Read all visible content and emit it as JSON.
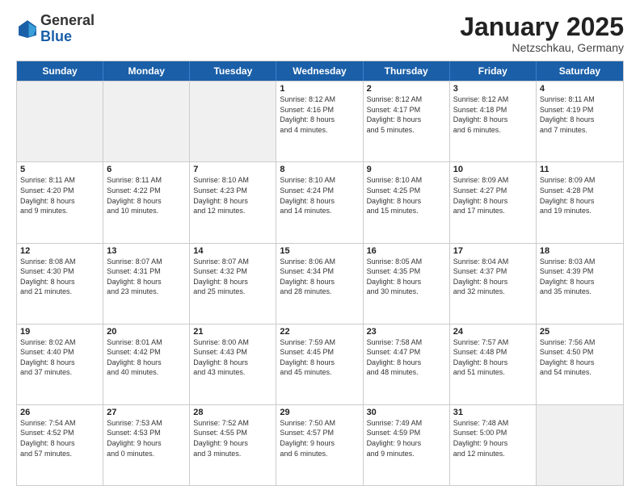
{
  "header": {
    "logo_general": "General",
    "logo_blue": "Blue",
    "month_title": "January 2025",
    "location": "Netzschkau, Germany"
  },
  "weekdays": [
    "Sunday",
    "Monday",
    "Tuesday",
    "Wednesday",
    "Thursday",
    "Friday",
    "Saturday"
  ],
  "rows": [
    [
      {
        "day": "",
        "info": "",
        "shaded": true
      },
      {
        "day": "",
        "info": "",
        "shaded": true
      },
      {
        "day": "",
        "info": "",
        "shaded": true
      },
      {
        "day": "1",
        "info": "Sunrise: 8:12 AM\nSunset: 4:16 PM\nDaylight: 8 hours\nand 4 minutes.",
        "shaded": false
      },
      {
        "day": "2",
        "info": "Sunrise: 8:12 AM\nSunset: 4:17 PM\nDaylight: 8 hours\nand 5 minutes.",
        "shaded": false
      },
      {
        "day": "3",
        "info": "Sunrise: 8:12 AM\nSunset: 4:18 PM\nDaylight: 8 hours\nand 6 minutes.",
        "shaded": false
      },
      {
        "day": "4",
        "info": "Sunrise: 8:11 AM\nSunset: 4:19 PM\nDaylight: 8 hours\nand 7 minutes.",
        "shaded": false
      }
    ],
    [
      {
        "day": "5",
        "info": "Sunrise: 8:11 AM\nSunset: 4:20 PM\nDaylight: 8 hours\nand 9 minutes.",
        "shaded": false
      },
      {
        "day": "6",
        "info": "Sunrise: 8:11 AM\nSunset: 4:22 PM\nDaylight: 8 hours\nand 10 minutes.",
        "shaded": false
      },
      {
        "day": "7",
        "info": "Sunrise: 8:10 AM\nSunset: 4:23 PM\nDaylight: 8 hours\nand 12 minutes.",
        "shaded": false
      },
      {
        "day": "8",
        "info": "Sunrise: 8:10 AM\nSunset: 4:24 PM\nDaylight: 8 hours\nand 14 minutes.",
        "shaded": false
      },
      {
        "day": "9",
        "info": "Sunrise: 8:10 AM\nSunset: 4:25 PM\nDaylight: 8 hours\nand 15 minutes.",
        "shaded": false
      },
      {
        "day": "10",
        "info": "Sunrise: 8:09 AM\nSunset: 4:27 PM\nDaylight: 8 hours\nand 17 minutes.",
        "shaded": false
      },
      {
        "day": "11",
        "info": "Sunrise: 8:09 AM\nSunset: 4:28 PM\nDaylight: 8 hours\nand 19 minutes.",
        "shaded": false
      }
    ],
    [
      {
        "day": "12",
        "info": "Sunrise: 8:08 AM\nSunset: 4:30 PM\nDaylight: 8 hours\nand 21 minutes.",
        "shaded": false
      },
      {
        "day": "13",
        "info": "Sunrise: 8:07 AM\nSunset: 4:31 PM\nDaylight: 8 hours\nand 23 minutes.",
        "shaded": false
      },
      {
        "day": "14",
        "info": "Sunrise: 8:07 AM\nSunset: 4:32 PM\nDaylight: 8 hours\nand 25 minutes.",
        "shaded": false
      },
      {
        "day": "15",
        "info": "Sunrise: 8:06 AM\nSunset: 4:34 PM\nDaylight: 8 hours\nand 28 minutes.",
        "shaded": false
      },
      {
        "day": "16",
        "info": "Sunrise: 8:05 AM\nSunset: 4:35 PM\nDaylight: 8 hours\nand 30 minutes.",
        "shaded": false
      },
      {
        "day": "17",
        "info": "Sunrise: 8:04 AM\nSunset: 4:37 PM\nDaylight: 8 hours\nand 32 minutes.",
        "shaded": false
      },
      {
        "day": "18",
        "info": "Sunrise: 8:03 AM\nSunset: 4:39 PM\nDaylight: 8 hours\nand 35 minutes.",
        "shaded": false
      }
    ],
    [
      {
        "day": "19",
        "info": "Sunrise: 8:02 AM\nSunset: 4:40 PM\nDaylight: 8 hours\nand 37 minutes.",
        "shaded": false
      },
      {
        "day": "20",
        "info": "Sunrise: 8:01 AM\nSunset: 4:42 PM\nDaylight: 8 hours\nand 40 minutes.",
        "shaded": false
      },
      {
        "day": "21",
        "info": "Sunrise: 8:00 AM\nSunset: 4:43 PM\nDaylight: 8 hours\nand 43 minutes.",
        "shaded": false
      },
      {
        "day": "22",
        "info": "Sunrise: 7:59 AM\nSunset: 4:45 PM\nDaylight: 8 hours\nand 45 minutes.",
        "shaded": false
      },
      {
        "day": "23",
        "info": "Sunrise: 7:58 AM\nSunset: 4:47 PM\nDaylight: 8 hours\nand 48 minutes.",
        "shaded": false
      },
      {
        "day": "24",
        "info": "Sunrise: 7:57 AM\nSunset: 4:48 PM\nDaylight: 8 hours\nand 51 minutes.",
        "shaded": false
      },
      {
        "day": "25",
        "info": "Sunrise: 7:56 AM\nSunset: 4:50 PM\nDaylight: 8 hours\nand 54 minutes.",
        "shaded": false
      }
    ],
    [
      {
        "day": "26",
        "info": "Sunrise: 7:54 AM\nSunset: 4:52 PM\nDaylight: 8 hours\nand 57 minutes.",
        "shaded": false
      },
      {
        "day": "27",
        "info": "Sunrise: 7:53 AM\nSunset: 4:53 PM\nDaylight: 9 hours\nand 0 minutes.",
        "shaded": false
      },
      {
        "day": "28",
        "info": "Sunrise: 7:52 AM\nSunset: 4:55 PM\nDaylight: 9 hours\nand 3 minutes.",
        "shaded": false
      },
      {
        "day": "29",
        "info": "Sunrise: 7:50 AM\nSunset: 4:57 PM\nDaylight: 9 hours\nand 6 minutes.",
        "shaded": false
      },
      {
        "day": "30",
        "info": "Sunrise: 7:49 AM\nSunset: 4:59 PM\nDaylight: 9 hours\nand 9 minutes.",
        "shaded": false
      },
      {
        "day": "31",
        "info": "Sunrise: 7:48 AM\nSunset: 5:00 PM\nDaylight: 9 hours\nand 12 minutes.",
        "shaded": false
      },
      {
        "day": "",
        "info": "",
        "shaded": true
      }
    ]
  ]
}
